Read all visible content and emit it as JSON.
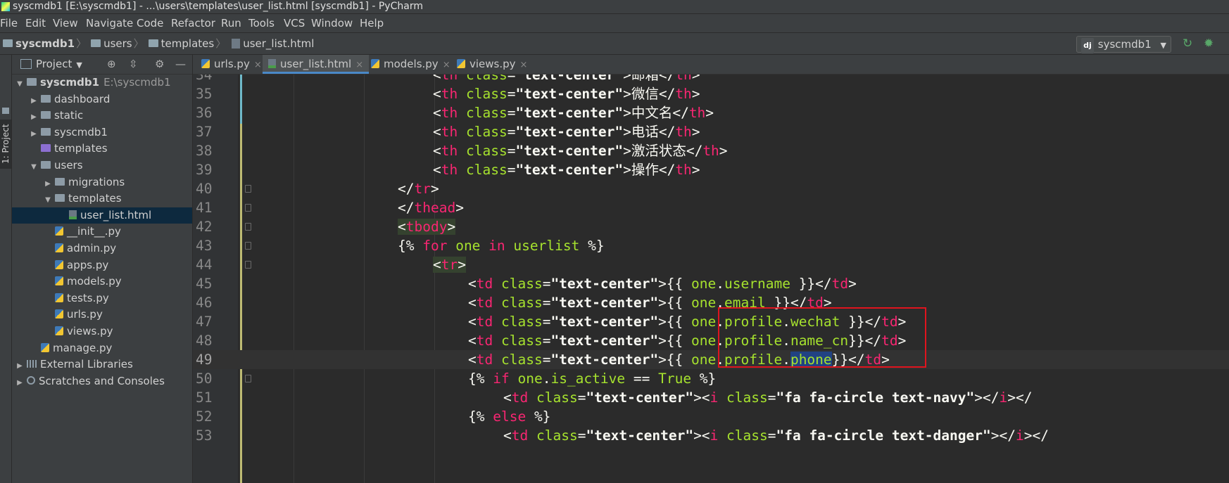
{
  "window": {
    "title": "syscmdb1 [E:\\syscmdb1] - ...\\users\\templates\\user_list.html [syscmdb1] - PyCharm"
  },
  "menu": [
    "File",
    "Edit",
    "View",
    "Navigate",
    "Code",
    "Refactor",
    "Run",
    "Tools",
    "VCS",
    "Window",
    "Help"
  ],
  "breadcrumb": [
    "syscmdb1",
    "users",
    "templates",
    "user_list.html"
  ],
  "run_config": {
    "badge": "dj",
    "name": "syscmdb1"
  },
  "toolstrip": {
    "project_label": "1: Project"
  },
  "project_panel": {
    "title": "Project",
    "tree": [
      {
        "label": "syscmdb1",
        "path": "E:\\syscmdb1",
        "kind": "folder",
        "bold": true,
        "arrow": "▼"
      },
      {
        "label": "dashboard",
        "kind": "folder",
        "arrow": "▶"
      },
      {
        "label": "static",
        "kind": "folder",
        "arrow": "▶"
      },
      {
        "label": "syscmdb1",
        "kind": "folder",
        "arrow": "▶"
      },
      {
        "label": "templates",
        "kind": "folder-purple",
        "arrow": ""
      },
      {
        "label": "users",
        "kind": "folder",
        "arrow": "▼"
      },
      {
        "label": "migrations",
        "kind": "folder",
        "arrow": "▶"
      },
      {
        "label": "templates",
        "kind": "folder",
        "arrow": "▼"
      },
      {
        "label": "user_list.html",
        "kind": "html",
        "arrow": "",
        "selected": true
      },
      {
        "label": "__init__.py",
        "kind": "py",
        "arrow": ""
      },
      {
        "label": "admin.py",
        "kind": "py",
        "arrow": ""
      },
      {
        "label": "apps.py",
        "kind": "py",
        "arrow": ""
      },
      {
        "label": "models.py",
        "kind": "py",
        "arrow": ""
      },
      {
        "label": "tests.py",
        "kind": "py",
        "arrow": ""
      },
      {
        "label": "urls.py",
        "kind": "py",
        "arrow": ""
      },
      {
        "label": "views.py",
        "kind": "py",
        "arrow": ""
      },
      {
        "label": "manage.py",
        "kind": "py",
        "arrow": ""
      },
      {
        "label": "External Libraries",
        "kind": "lib",
        "arrow": "▶"
      },
      {
        "label": "Scratches and Consoles",
        "kind": "scratch",
        "arrow": "▶"
      }
    ]
  },
  "tabs": [
    {
      "label": "urls.py",
      "kind": "py",
      "active": false
    },
    {
      "label": "user_list.html",
      "kind": "html",
      "active": true
    },
    {
      "label": "models.py",
      "kind": "py",
      "active": false
    },
    {
      "label": "views.py",
      "kind": "py",
      "active": false
    }
  ],
  "editor": {
    "current_line": 49,
    "lines": [
      {
        "n": "34",
        "indent": 10,
        "tokens": [
          [
            "br",
            "<"
          ],
          [
            "kw",
            "th "
          ],
          [
            "attr",
            "class"
          ],
          [
            "br",
            "="
          ],
          [
            "str",
            "\"text-center\""
          ],
          [
            "br",
            ">"
          ],
          [
            "tx",
            "邮箱"
          ],
          [
            "br",
            "</"
          ],
          [
            "kw",
            "th"
          ],
          [
            "br",
            ">"
          ]
        ]
      },
      {
        "n": "35",
        "indent": 10,
        "tokens": [
          [
            "br",
            "<"
          ],
          [
            "kw",
            "th "
          ],
          [
            "attr",
            "class"
          ],
          [
            "br",
            "="
          ],
          [
            "str",
            "\"text-center\""
          ],
          [
            "br",
            ">"
          ],
          [
            "tx",
            "微信"
          ],
          [
            "br",
            "</"
          ],
          [
            "kw",
            "th"
          ],
          [
            "br",
            ">"
          ]
        ]
      },
      {
        "n": "36",
        "indent": 10,
        "tokens": [
          [
            "br",
            "<"
          ],
          [
            "kw",
            "th "
          ],
          [
            "attr",
            "class"
          ],
          [
            "br",
            "="
          ],
          [
            "str",
            "\"text-center\""
          ],
          [
            "br",
            ">"
          ],
          [
            "tx",
            "中文名"
          ],
          [
            "br",
            "</"
          ],
          [
            "kw",
            "th"
          ],
          [
            "br",
            ">"
          ]
        ]
      },
      {
        "n": "37",
        "indent": 10,
        "tokens": [
          [
            "br",
            "<"
          ],
          [
            "kw",
            "th "
          ],
          [
            "attr",
            "class"
          ],
          [
            "br",
            "="
          ],
          [
            "str",
            "\"text-center\""
          ],
          [
            "br",
            ">"
          ],
          [
            "tx",
            "电话"
          ],
          [
            "br",
            "</"
          ],
          [
            "kw",
            "th"
          ],
          [
            "br",
            ">"
          ]
        ]
      },
      {
        "n": "38",
        "indent": 10,
        "tokens": [
          [
            "br",
            "<"
          ],
          [
            "kw",
            "th "
          ],
          [
            "attr",
            "class"
          ],
          [
            "br",
            "="
          ],
          [
            "str",
            "\"text-center\""
          ],
          [
            "br",
            ">"
          ],
          [
            "tx",
            "激活状态"
          ],
          [
            "br",
            "</"
          ],
          [
            "kw",
            "th"
          ],
          [
            "br",
            ">"
          ]
        ]
      },
      {
        "n": "39",
        "indent": 10,
        "tokens": [
          [
            "br",
            "<"
          ],
          [
            "kw",
            "th "
          ],
          [
            "attr",
            "class"
          ],
          [
            "br",
            "="
          ],
          [
            "str",
            "\"text-center\""
          ],
          [
            "br",
            ">"
          ],
          [
            "tx",
            "操作"
          ],
          [
            "br",
            "</"
          ],
          [
            "kw",
            "th"
          ],
          [
            "br",
            ">"
          ]
        ]
      },
      {
        "n": "40",
        "indent": 8,
        "tokens": [
          [
            "br",
            "</"
          ],
          [
            "kw",
            "tr"
          ],
          [
            "br",
            ">"
          ]
        ]
      },
      {
        "n": "41",
        "indent": 8,
        "tokens": [
          [
            "br",
            "</"
          ],
          [
            "kw",
            "thead"
          ],
          [
            "br",
            ">"
          ]
        ]
      },
      {
        "n": "42",
        "indent": 8,
        "tokens": [
          [
            "hl-br",
            "<"
          ],
          [
            "hl-kw",
            "tbody"
          ],
          [
            "hl-br",
            ">"
          ]
        ]
      },
      {
        "n": "43",
        "indent": 8,
        "tokens": [
          [
            "br",
            "{% "
          ],
          [
            "kw",
            "for "
          ],
          [
            "var",
            "one "
          ],
          [
            "kw",
            "in "
          ],
          [
            "var",
            "userlist "
          ],
          [
            "br",
            "%}"
          ]
        ]
      },
      {
        "n": "44",
        "indent": 10,
        "tokens": [
          [
            "hl-br",
            "<"
          ],
          [
            "hl-kw",
            "tr"
          ],
          [
            "hl-br",
            ">"
          ]
        ]
      },
      {
        "n": "45",
        "indent": 12,
        "tokens": [
          [
            "br",
            "<"
          ],
          [
            "kw",
            "td "
          ],
          [
            "attr",
            "class"
          ],
          [
            "br",
            "="
          ],
          [
            "str",
            "\"text-center\""
          ],
          [
            "br",
            ">{{ "
          ],
          [
            "var",
            "one"
          ],
          [
            "br",
            "."
          ],
          [
            "var",
            "username "
          ],
          [
            "br",
            "}}</"
          ],
          [
            "kw",
            "td"
          ],
          [
            "br",
            ">"
          ]
        ]
      },
      {
        "n": "46",
        "indent": 12,
        "tokens": [
          [
            "br",
            "<"
          ],
          [
            "kw",
            "td "
          ],
          [
            "attr",
            "class"
          ],
          [
            "br",
            "="
          ],
          [
            "str",
            "\"text-center\""
          ],
          [
            "br",
            ">{{ "
          ],
          [
            "var",
            "one"
          ],
          [
            "br",
            "."
          ],
          [
            "var",
            "email "
          ],
          [
            "br",
            "}}</"
          ],
          [
            "kw",
            "td"
          ],
          [
            "br",
            ">"
          ]
        ]
      },
      {
        "n": "47",
        "indent": 12,
        "tokens": [
          [
            "br",
            "<"
          ],
          [
            "kw",
            "td "
          ],
          [
            "attr",
            "class"
          ],
          [
            "br",
            "="
          ],
          [
            "str",
            "\"text-center\""
          ],
          [
            "br",
            ">{{ "
          ],
          [
            "var",
            "one"
          ],
          [
            "br",
            "."
          ],
          [
            "var",
            "profile"
          ],
          [
            "br",
            "."
          ],
          [
            "var",
            "wechat "
          ],
          [
            "br",
            "}}</"
          ],
          [
            "kw",
            "td"
          ],
          [
            "br",
            ">"
          ]
        ]
      },
      {
        "n": "48",
        "indent": 12,
        "tokens": [
          [
            "br",
            "<"
          ],
          [
            "kw",
            "td "
          ],
          [
            "attr",
            "class"
          ],
          [
            "br",
            "="
          ],
          [
            "str",
            "\"text-center\""
          ],
          [
            "br",
            ">{{ "
          ],
          [
            "var",
            "one"
          ],
          [
            "br",
            "."
          ],
          [
            "var",
            "profile"
          ],
          [
            "br",
            "."
          ],
          [
            "var",
            "name_cn"
          ],
          [
            "br",
            "}}</"
          ],
          [
            "kw",
            "td"
          ],
          [
            "br",
            ">"
          ]
        ]
      },
      {
        "n": "49",
        "indent": 12,
        "tokens": [
          [
            "br",
            "<"
          ],
          [
            "kw",
            "td "
          ],
          [
            "attr",
            "class"
          ],
          [
            "br",
            "="
          ],
          [
            "str",
            "\"text-center\""
          ],
          [
            "br",
            ">{{ "
          ],
          [
            "var",
            "one"
          ],
          [
            "br",
            "."
          ],
          [
            "var",
            "profile"
          ],
          [
            "br",
            "."
          ],
          [
            "sel",
            "phone"
          ],
          [
            "br",
            "}}</"
          ],
          [
            "kw",
            "td"
          ],
          [
            "br",
            ">"
          ]
        ]
      },
      {
        "n": "50",
        "indent": 12,
        "tokens": [
          [
            "br",
            "{% "
          ],
          [
            "kw",
            "if "
          ],
          [
            "var",
            "one"
          ],
          [
            "br",
            "."
          ],
          [
            "var",
            "is_active "
          ],
          [
            "br",
            "== "
          ],
          [
            "var",
            "True "
          ],
          [
            "br",
            "%}"
          ]
        ]
      },
      {
        "n": "51",
        "indent": 14,
        "tokens": [
          [
            "br",
            "<"
          ],
          [
            "kw",
            "td "
          ],
          [
            "attr",
            "class"
          ],
          [
            "br",
            "="
          ],
          [
            "str",
            "\"text-center\""
          ],
          [
            "br",
            "><"
          ],
          [
            "kw",
            "i "
          ],
          [
            "attr",
            "class"
          ],
          [
            "br",
            "="
          ],
          [
            "str",
            "\"fa fa-circle text-navy\""
          ],
          [
            "br",
            "></"
          ],
          [
            "kw",
            "i"
          ],
          [
            "br",
            "></"
          ]
        ]
      },
      {
        "n": "52",
        "indent": 12,
        "tokens": [
          [
            "br",
            "{% "
          ],
          [
            "kw",
            "else "
          ],
          [
            "br",
            "%}"
          ]
        ]
      },
      {
        "n": "53",
        "indent": 14,
        "tokens": [
          [
            "br",
            "<"
          ],
          [
            "kw",
            "td "
          ],
          [
            "attr",
            "class"
          ],
          [
            "br",
            "="
          ],
          [
            "str",
            "\"text-center\""
          ],
          [
            "br",
            "><"
          ],
          [
            "kw",
            "i "
          ],
          [
            "attr",
            "class"
          ],
          [
            "br",
            "="
          ],
          [
            "str",
            "\"fa fa-circle text-danger\""
          ],
          [
            "br",
            "></"
          ],
          [
            "kw",
            "i"
          ],
          [
            "br",
            "></"
          ]
        ]
      }
    ]
  },
  "colors": {
    "accent": "#4a88c7",
    "highlight_box": "#e0141e",
    "selection": "#214283"
  }
}
